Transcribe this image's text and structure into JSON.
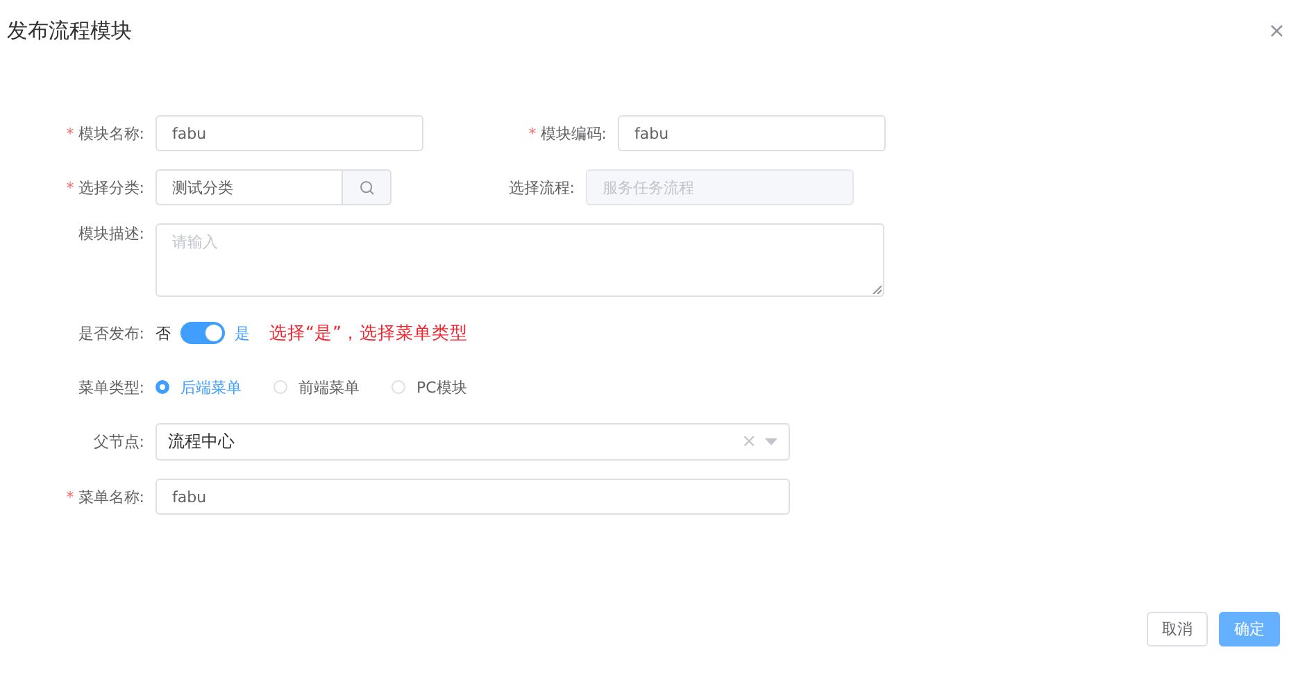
{
  "dialog": {
    "title": "发布流程模块",
    "close": "×"
  },
  "rows": [
    {
      "cells": [
        {
          "kind": "text",
          "marker": "*",
          "label": "模块名称:",
          "value": "fabu",
          "disabled": false
        },
        {
          "kind": "text",
          "marker": "*",
          "label": "模块编码:",
          "value": "fabu",
          "disabled": false
        }
      ]
    },
    {
      "cells": [
        {
          "kind": "search",
          "marker": "*",
          "label": "选择分类:",
          "value": "测试分类"
        },
        {
          "kind": "text",
          "label": "选择流程:",
          "value": "服务任务流程",
          "disabled": true
        }
      ]
    },
    {
      "cells": [
        {
          "kind": "textarea",
          "label": "模块描述:",
          "placeholder": "请输入"
        }
      ]
    },
    {
      "cells": [
        {
          "kind": "switch",
          "label": "是否发布:",
          "off_text": "否",
          "on_text": "是",
          "on": true,
          "note": "选择“是”，选择菜单类型"
        }
      ]
    },
    {
      "cells": [
        {
          "kind": "radio",
          "label": "菜单类型:",
          "options": [
            {
              "label": "后端菜单",
              "selected": true
            },
            {
              "label": "前端菜单",
              "selected": false
            },
            {
              "label": "PC模块",
              "selected": false
            }
          ]
        }
      ]
    },
    {
      "cells": [
        {
          "kind": "select",
          "label": "父节点:",
          "value": "流程中心",
          "clear": "×"
        }
      ]
    },
    {
      "cells": [
        {
          "kind": "text",
          "marker": "*",
          "label": "菜单名称:",
          "value": "fabu",
          "disabled": false
        }
      ]
    }
  ],
  "buttons": [
    {
      "label": "取消",
      "kind": "default"
    },
    {
      "label": "确定",
      "kind": "primary"
    }
  ]
}
